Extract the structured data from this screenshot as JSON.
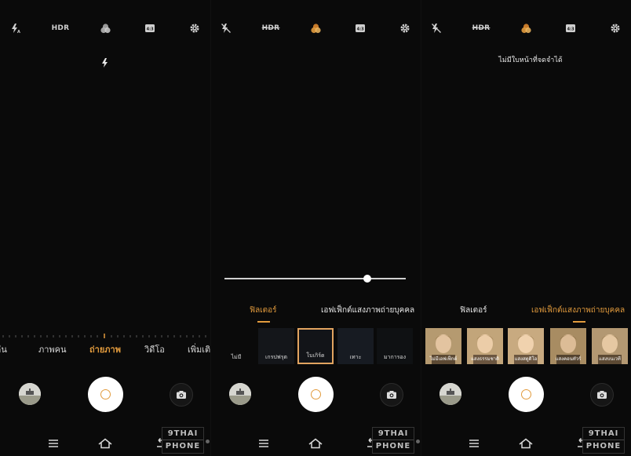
{
  "panel1": {
    "top": {
      "hdr": "HDR",
      "ratio": "4:3"
    },
    "modes": [
      "คืน",
      "ภาพคน",
      "ถ่ายภาพ",
      "วิดีโอ",
      "เพิ่มเติ"
    ]
  },
  "panel2": {
    "top": {
      "hdr": "HDR",
      "ratio": "4:3"
    },
    "slider_value": 0.79,
    "tabs": [
      "ฟิลเตอร์",
      "เอฟเฟ็กต์แสงภาพถ่ายบุคคล"
    ],
    "active_tab": "ฟิลเตอร์",
    "filters": [
      "ไม่มี",
      "เกรปฟรุต",
      "โบเกิร์ด",
      "เทาะ",
      "มาการอง"
    ],
    "selected_filter": "โบเกิร์ด"
  },
  "panel3": {
    "top": {
      "hdr": "HDR",
      "ratio": "4:3"
    },
    "notice": "ไม่มีใบหน้าที่จดจำได้",
    "tabs": [
      "ฟิลเตอร์",
      "เอฟเฟ็กต์แสงภาพถ่ายบุคคล"
    ],
    "active_tab": "เอฟเฟ็กต์แสงภาพถ่ายบุคคล",
    "effects": [
      "ไม่มีเอฟเฟ็กต์",
      "แสงธรรมชาติ",
      "แสงสตูดิโอ",
      "แสงคอนทัวร์",
      "แสงบนเวที"
    ],
    "selected_effect": "แสงสตูดิโอ"
  },
  "watermark": {
    "line1": "9THAI",
    "line2": "PHONE"
  },
  "colors": {
    "accent": "#e29b3d",
    "background": "#0a0a0a"
  },
  "icons": [
    "flash-auto-icon",
    "flash-off-icon",
    "hdr-icon",
    "hdr-off-icon",
    "filter-icon",
    "aspect-ratio-icon",
    "settings-icon",
    "flash-indicator-icon",
    "camera-switch-icon",
    "shutter-icon",
    "gallery-thumbnail-icon",
    "menu-icon",
    "home-icon",
    "back-icon"
  ]
}
